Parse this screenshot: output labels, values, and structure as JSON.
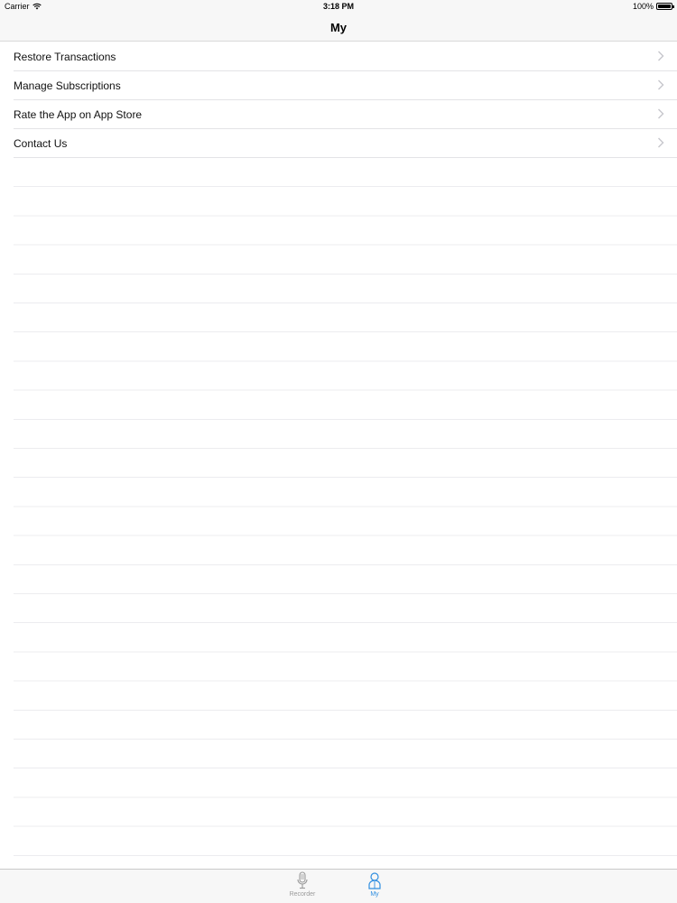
{
  "status_bar": {
    "carrier": "Carrier",
    "time": "3:18 PM",
    "battery": "100%"
  },
  "nav": {
    "title": "My"
  },
  "menu": {
    "items": [
      {
        "label": "Restore Transactions",
        "icon": "chevron-right-icon"
      },
      {
        "label": "Manage Subscriptions",
        "icon": "chevron-right-icon"
      },
      {
        "label": "Rate the App on App Store",
        "icon": "chevron-right-icon"
      },
      {
        "label": "Contact Us",
        "icon": "chevron-right-icon"
      }
    ]
  },
  "tab_bar": {
    "tabs": [
      {
        "label": "Recorder",
        "icon": "microphone-icon",
        "selected": false
      },
      {
        "label": "My",
        "icon": "person-icon",
        "selected": true
      }
    ],
    "active_color": "#2f8ee0",
    "inactive_color": "#9b9b9b"
  }
}
